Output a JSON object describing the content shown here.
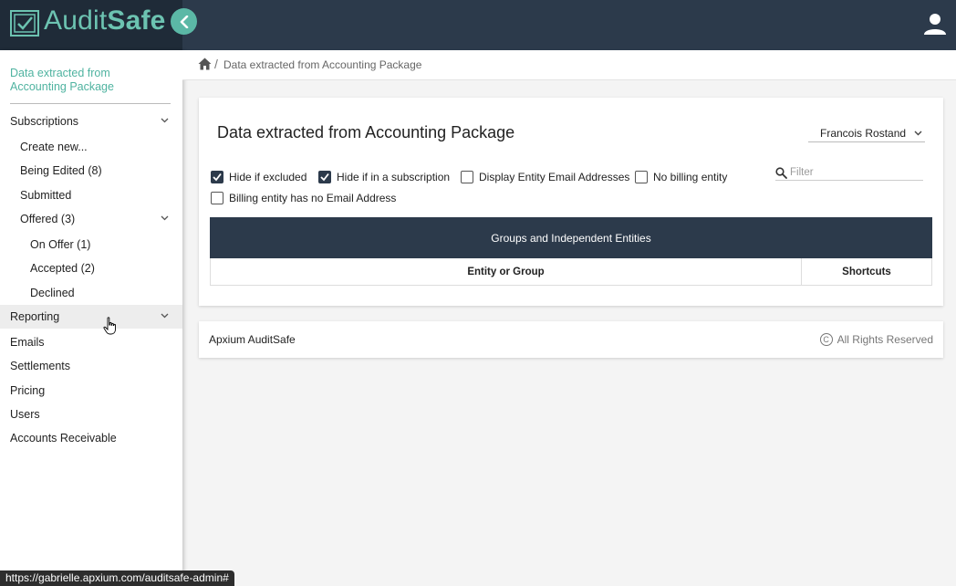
{
  "app": {
    "name_part1": "Audit",
    "name_part2": "Safe"
  },
  "header": {
    "collapse_icon": "chevron-left-icon",
    "user_icon": "person-icon"
  },
  "sidebar": {
    "heading": "Data extracted from Accounting Package",
    "items": [
      {
        "label": "Subscriptions",
        "expandable": true
      },
      {
        "label": "Create new..."
      },
      {
        "label": "Being Edited (8)"
      },
      {
        "label": "Submitted"
      },
      {
        "label": "Offered (3)",
        "expandable": true
      },
      {
        "label": "On Offer (1)"
      },
      {
        "label": "Accepted (2)"
      },
      {
        "label": "Declined"
      },
      {
        "label": "Reporting",
        "expandable": true
      },
      {
        "label": "Emails"
      },
      {
        "label": "Settlements"
      },
      {
        "label": "Pricing"
      },
      {
        "label": "Users"
      },
      {
        "label": "Accounts Receivable"
      }
    ]
  },
  "breadcrumb": {
    "current": "Data extracted from Accounting Package",
    "separator": "/"
  },
  "page": {
    "title": "Data extracted from Accounting Package",
    "user_select": "Francois Rostand",
    "checkboxes": [
      {
        "label": "Hide if excluded",
        "checked": true
      },
      {
        "label": "Hide if in a subscription",
        "checked": true
      },
      {
        "label": "Display Entity Email Addresses",
        "checked": false
      },
      {
        "label": "No billing entity",
        "checked": false
      },
      {
        "label": "Billing entity has no Email Address",
        "checked": false
      }
    ],
    "filter_placeholder": "Filter",
    "grid": {
      "group_header": "Groups and Independent Entities",
      "columns": [
        "Entity or Group",
        "Shortcuts"
      ]
    }
  },
  "footer": {
    "left": "Apxium AuditSafe",
    "right": "All Rights Reserved",
    "copyright_symbol": "C"
  },
  "status_bar": {
    "url": "https://gabrielle.apxium.com/auditsafe-admin#"
  },
  "colors": {
    "accent": "#5bb8a6",
    "header_bg": "#2c3a4b",
    "logo_bg": "#1f2b38"
  }
}
